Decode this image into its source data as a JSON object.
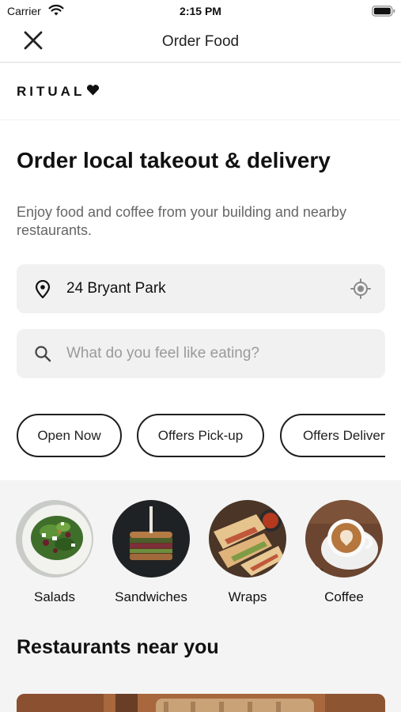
{
  "status_bar": {
    "carrier": "Carrier",
    "time": "2:15 PM"
  },
  "nav": {
    "title": "Order Food",
    "close_icon": "close-icon"
  },
  "brand": {
    "name": "RITUAL"
  },
  "hero": {
    "headline": "Order local takeout & delivery",
    "subtitle": "Enjoy food and coffee from your building and nearby restaurants."
  },
  "location": {
    "value": "24 Bryant Park",
    "icon": "map-pin-icon",
    "action_icon": "locate-icon"
  },
  "search": {
    "placeholder": "What do you feel like eating?",
    "icon": "search-icon"
  },
  "filters": [
    {
      "label": "Open Now"
    },
    {
      "label": "Offers Pick-up"
    },
    {
      "label": "Offers Delivery"
    }
  ],
  "categories": [
    {
      "label": "Salads"
    },
    {
      "label": "Sandwiches"
    },
    {
      "label": "Wraps"
    },
    {
      "label": "Coffee"
    }
  ],
  "restaurants": {
    "title": "Restaurants near you"
  },
  "colors": {
    "chip_border": "#1e1e1e",
    "field_bg": "#f1f1f1",
    "muted_text": "#666666"
  }
}
